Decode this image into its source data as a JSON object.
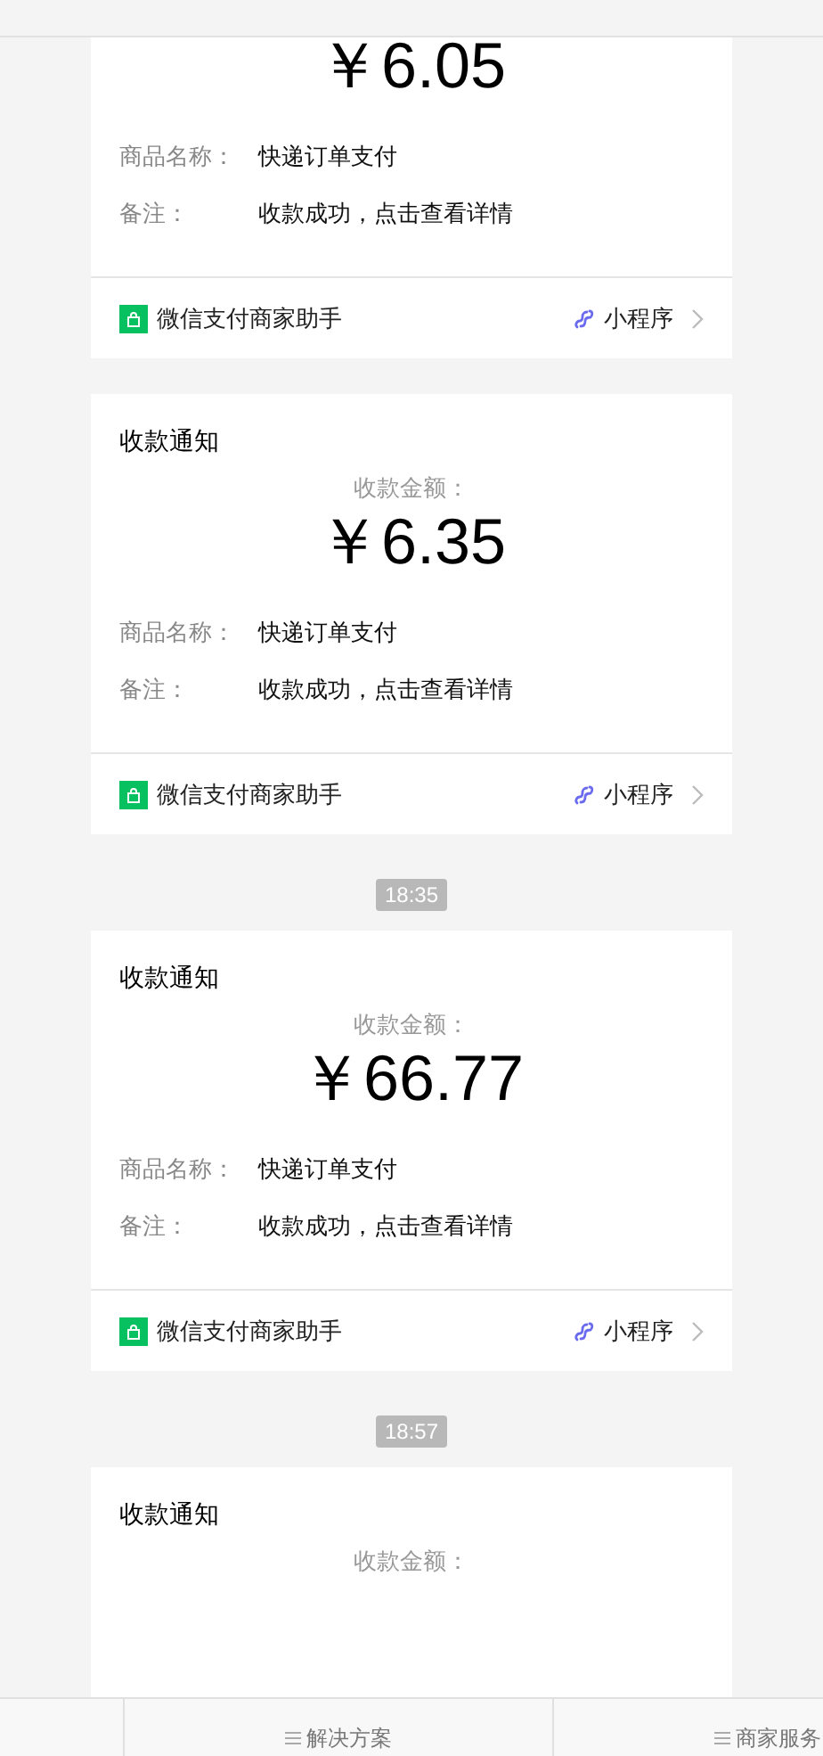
{
  "messages": [
    {
      "amount": "￥6.05",
      "fields": [
        {
          "label": "商品名称：",
          "value": "快递订单支付"
        },
        {
          "label": "备注：",
          "value": "收款成功，点击查看详情"
        }
      ],
      "source": "微信支付商家助手",
      "link": "小程序"
    },
    {
      "title": "收款通知",
      "amount_label": "收款金额：",
      "amount": "￥6.35",
      "fields": [
        {
          "label": "商品名称：",
          "value": "快递订单支付"
        },
        {
          "label": "备注：",
          "value": "收款成功，点击查看详情"
        }
      ],
      "source": "微信支付商家助手",
      "link": "小程序"
    },
    {
      "time": "18:35",
      "title": "收款通知",
      "amount_label": "收款金额：",
      "amount": "￥66.77",
      "fields": [
        {
          "label": "商品名称：",
          "value": "快递订单支付"
        },
        {
          "label": "备注：",
          "value": "收款成功，点击查看详情"
        }
      ],
      "source": "微信支付商家助手",
      "link": "小程序"
    },
    {
      "time": "18:57",
      "title": "收款通知",
      "amount_label": "收款金额："
    }
  ],
  "bottom_menu": [
    {
      "label": "解决方案"
    },
    {
      "label": "商家服务"
    }
  ]
}
